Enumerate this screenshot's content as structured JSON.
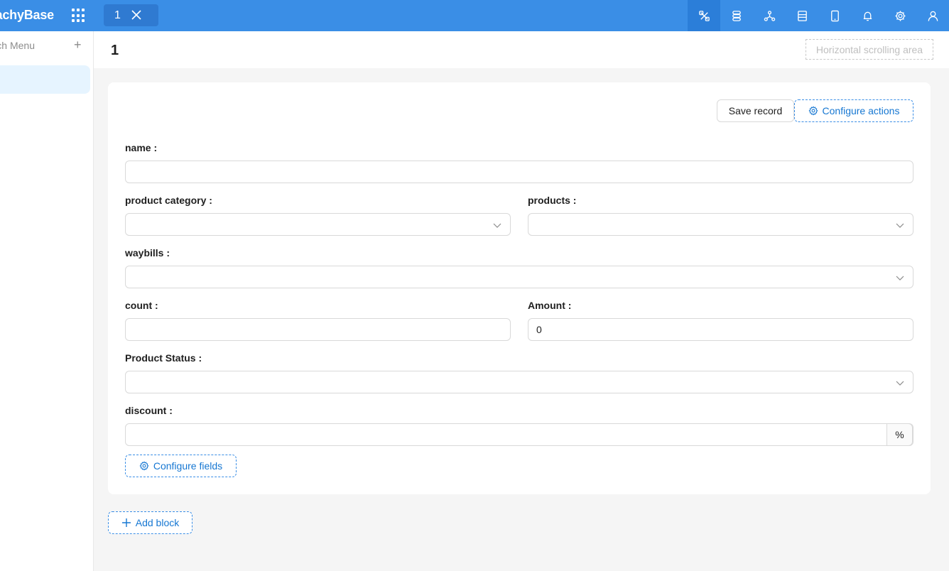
{
  "app": {
    "logo_text": "achyBase",
    "tab_label": "1"
  },
  "toolbar_icons": [
    "ui-editor-icon",
    "workflow-icon",
    "collection-icon",
    "block-template-icon",
    "mobile-icon",
    "bell-icon",
    "gear-icon",
    "user-icon"
  ],
  "sidebar": {
    "search_label": "ch Menu",
    "add_icon": "+"
  },
  "page": {
    "title": "1",
    "hscroll_label": "Horizontal scrolling area"
  },
  "form": {
    "save_label": "Save record",
    "configure_actions_label": "Configure actions",
    "configure_fields_label": "Configure fields",
    "fields": {
      "name": {
        "label": "name",
        "value": ""
      },
      "product_category": {
        "label": "product category",
        "value": ""
      },
      "products": {
        "label": "products",
        "value": ""
      },
      "waybills": {
        "label": "waybills",
        "value": ""
      },
      "count": {
        "label": "count",
        "value": ""
      },
      "amount": {
        "label": "Amount",
        "value": "0"
      },
      "product_status": {
        "label": "Product Status",
        "value": ""
      },
      "discount": {
        "label": "discount",
        "value": "",
        "suffix": "%"
      }
    },
    "colon": ":"
  },
  "add_block_label": "Add block",
  "colors": {
    "topbar": "#3a8ee6",
    "accent": "#1677d2"
  }
}
